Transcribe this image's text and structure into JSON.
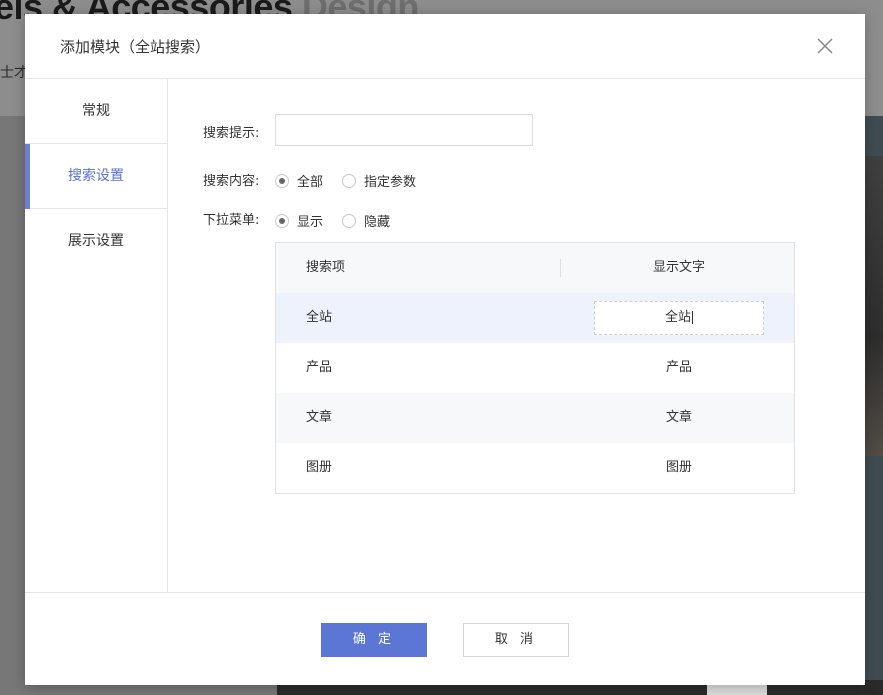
{
  "background": {
    "heading_main": "els & Accessories",
    "heading_faded": "Design",
    "subtitle": "士才"
  },
  "modal": {
    "title": "添加模块（全站搜索）",
    "close_icon": "close-icon"
  },
  "sidenav": {
    "items": [
      {
        "label": "常规"
      },
      {
        "label": "搜索设置"
      },
      {
        "label": "展示设置"
      }
    ],
    "active": "搜索设置"
  },
  "form": {
    "search_hint_label": "搜索提示:",
    "search_hint_value": "",
    "search_content_label": "搜索内容:",
    "search_content_options": [
      "全部",
      "指定参数"
    ],
    "search_content_selected": "全部",
    "dropdown_label": "下拉菜单:",
    "dropdown_options": [
      "显示",
      "隐藏"
    ],
    "dropdown_selected": "显示"
  },
  "table": {
    "headers": [
      "搜索项",
      "显示文字"
    ],
    "rows": [
      {
        "item": "全站",
        "text": "全站"
      },
      {
        "item": "产品",
        "text": "产品"
      },
      {
        "item": "文章",
        "text": "文章"
      },
      {
        "item": "图册",
        "text": "图册"
      }
    ]
  },
  "footer": {
    "ok_label": "确 定",
    "cancel_label": "取 消"
  },
  "colors": {
    "accent": "#5c76d6",
    "active_row": "#edf2fd"
  }
}
